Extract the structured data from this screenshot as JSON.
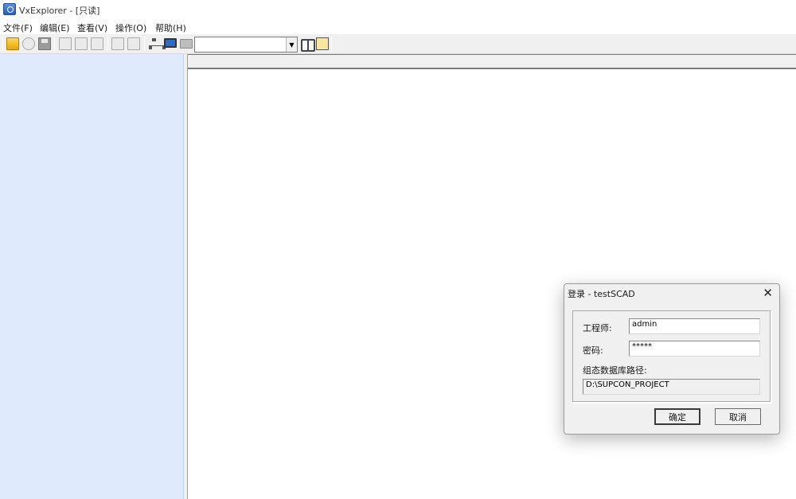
{
  "window": {
    "title": "VxExplorer - [只读]"
  },
  "menu": [
    {
      "label": "文件(F)"
    },
    {
      "label": "编辑(E)"
    },
    {
      "label": "查看(V)"
    },
    {
      "label": "操作(O)"
    },
    {
      "label": "帮助(H)"
    }
  ],
  "toolbar": {
    "icons": [
      "open-folder-icon",
      "refresh-icon",
      "save-icon",
      "cut-icon",
      "copy-icon",
      "paste-icon",
      "add-icon",
      "delete-icon",
      "tree-structure-icon",
      "monitor-icon",
      "folder-icon",
      "find-icon",
      "screen-icon"
    ],
    "combo_value": ""
  },
  "dialog": {
    "title": "登录 - testSCAD",
    "engineer_label": "工程师:",
    "engineer_value": "admin",
    "password_label": "密码:",
    "password_value": "*****",
    "db_path_label": "组态数据库路径:",
    "db_path_value": "D:\\SUPCON_PROJECT",
    "ok_label": "确定",
    "cancel_label": "取消",
    "close_glyph": "✕"
  }
}
